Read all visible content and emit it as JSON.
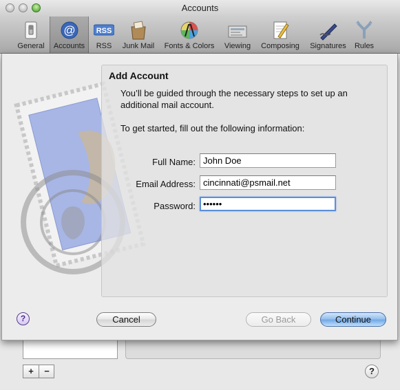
{
  "window": {
    "title": "Accounts"
  },
  "toolbar": {
    "items": [
      {
        "label": "General",
        "icon": "light-switch-icon"
      },
      {
        "label": "Accounts",
        "icon": "at-sign-icon",
        "selected": true
      },
      {
        "label": "RSS",
        "icon": "rss-icon"
      },
      {
        "label": "Junk Mail",
        "icon": "junk-mail-icon"
      },
      {
        "label": "Fonts & Colors",
        "icon": "fonts-colors-icon"
      },
      {
        "label": "Viewing",
        "icon": "viewing-icon"
      },
      {
        "label": "Composing",
        "icon": "composing-icon"
      },
      {
        "label": "Signatures",
        "icon": "signature-pen-icon"
      },
      {
        "label": "Rules",
        "icon": "rules-icon"
      }
    ],
    "rss_text": "RSS",
    "at_text": "@"
  },
  "sheet": {
    "heading": "Add Account",
    "intro": "You’ll be guided through the necessary steps to set up an additional mail account.",
    "prompt": "To get started, fill out the following information:",
    "full_name": {
      "label": "Full Name:",
      "value": "John Doe"
    },
    "email": {
      "label": "Email Address:",
      "value": "cincinnati@psmail.net"
    },
    "password": {
      "label": "Password:",
      "value": "••••••"
    },
    "help_label": "?",
    "cancel_label": "Cancel",
    "go_back_label": "Go Back",
    "continue_label": "Continue"
  },
  "pane": {
    "add_label": "+",
    "remove_label": "−",
    "help_label": "?"
  },
  "colors": {
    "accent": "#6fa6e5",
    "focus_ring": "#5c8fd6"
  }
}
